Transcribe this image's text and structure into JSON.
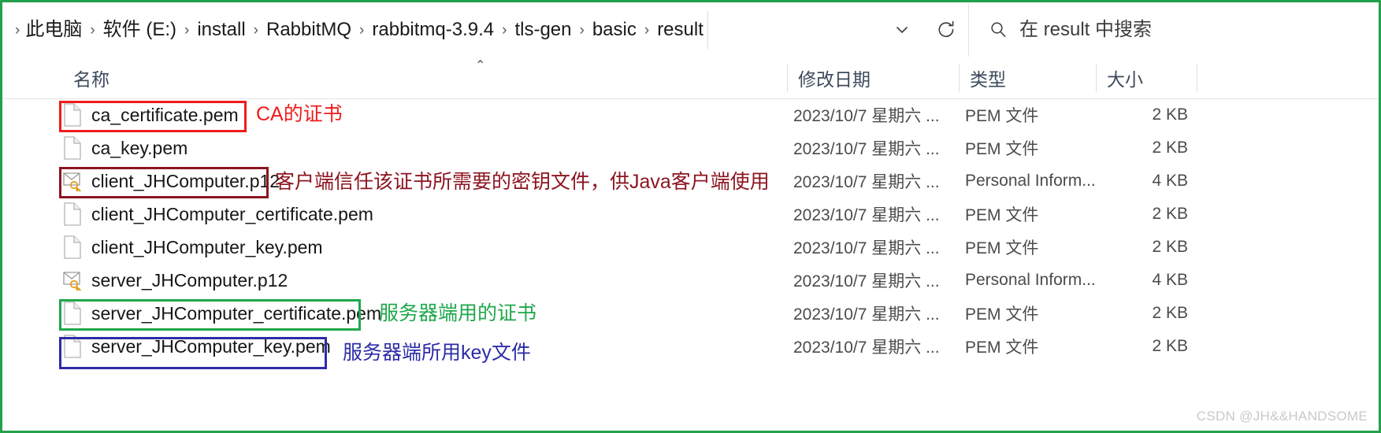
{
  "window": {
    "frame_color": "#22a04a"
  },
  "addressbar": {
    "breadcrumbs": [
      "此电脑",
      "软件 (E:)",
      "install",
      "RabbitMQ",
      "rabbitmq-3.9.4",
      "tls-gen",
      "basic",
      "result"
    ],
    "separator": "›",
    "chevron_icon": "chevron-down-icon",
    "refresh_icon": "refresh-icon",
    "search": {
      "icon": "search-icon",
      "placeholder": "在 result 中搜索",
      "value": ""
    }
  },
  "columns": {
    "name": "名称",
    "date": "修改日期",
    "type": "类型",
    "size": "大小",
    "sort_indicator": "⌃",
    "sort_column": "名称",
    "sort_direction": "ascending"
  },
  "files": [
    {
      "name": "ca_certificate.pem",
      "icon": "pem-file-icon",
      "date": "2023/10/7  星期六 ...",
      "type": "PEM 文件",
      "size": "2 KB"
    },
    {
      "name": "ca_key.pem",
      "icon": "pem-file-icon",
      "date": "2023/10/7  星期六 ...",
      "type": "PEM 文件",
      "size": "2 KB"
    },
    {
      "name": "client_JHComputer.p12",
      "icon": "p12-certificate-icon",
      "date": "2023/10/7  星期六 ...",
      "type": "Personal Inform...",
      "size": "4 KB"
    },
    {
      "name": "client_JHComputer_certificate.pem",
      "icon": "pem-file-icon",
      "date": "2023/10/7  星期六 ...",
      "type": "PEM 文件",
      "size": "2 KB"
    },
    {
      "name": "client_JHComputer_key.pem",
      "icon": "pem-file-icon",
      "date": "2023/10/7  星期六 ...",
      "type": "PEM 文件",
      "size": "2 KB"
    },
    {
      "name": "server_JHComputer.p12",
      "icon": "p12-certificate-icon",
      "date": "2023/10/7  星期六 ...",
      "type": "Personal Inform...",
      "size": "4 KB"
    },
    {
      "name": "server_JHComputer_certificate.pem",
      "icon": "pem-file-icon",
      "date": "2023/10/7  星期六 ...",
      "type": "PEM 文件",
      "size": "2 KB"
    },
    {
      "name": "server_JHComputer_key.pem",
      "icon": "pem-file-icon",
      "date": "2023/10/7  星期六 ...",
      "type": "PEM 文件",
      "size": "2 KB"
    }
  ],
  "annotations": [
    {
      "target": "ca_certificate.pem",
      "color": "#ee1c1c",
      "text": "CA的证书"
    },
    {
      "target": "client_JHComputer.p12",
      "color": "#8c1520",
      "text": "客户端信任该证书所需要的密钥文件，供Java客户端使用"
    },
    {
      "target": "server_JHComputer_certificate.pem",
      "color": "#1fa84b",
      "text": "服务器端用的证书"
    },
    {
      "target": "server_JHComputer_key.pem",
      "color": "#2c2ca8",
      "text": "服务器端所用key文件"
    }
  ],
  "watermark": "CSDN @JH&&HANDSOME"
}
